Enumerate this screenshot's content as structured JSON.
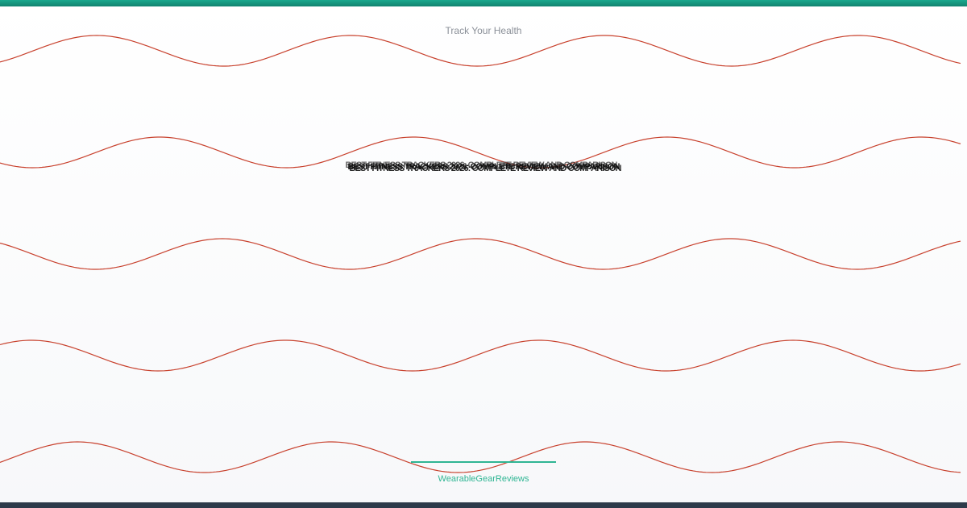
{
  "header": {
    "tagline": "Track Your Health"
  },
  "main": {
    "title": "BEST FITNESS TRACKERS 2026: COMPLETE REVIEW AND COMPARISON"
  },
  "footer": {
    "brand": "WearableGearReviews"
  },
  "colors": {
    "accent": "#1aa98e",
    "wave": "#c8412d",
    "bottom_bar": "#2d3a4a",
    "tagline": "#8a8f98",
    "brand_text": "#2fb593"
  },
  "decoration": {
    "wave_count": 5
  }
}
